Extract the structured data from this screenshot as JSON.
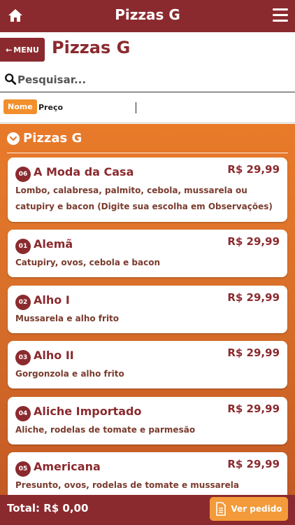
{
  "header": {
    "title": "Pizzas G",
    "home_icon": "home-icon",
    "menu_icon": "hamburger-menu-icon"
  },
  "subheader": {
    "back_label": "MENU",
    "page_title": "Pizzas G"
  },
  "search": {
    "placeholder": "Pesquisar...",
    "value": ""
  },
  "sort": {
    "nome_label": "Nome",
    "preco_label": "Preço",
    "active": "Nome"
  },
  "section": {
    "title": "Pizzas G"
  },
  "items": [
    {
      "num": "06",
      "name": "A Moda da Casa",
      "price": "R$ 29,99",
      "desc": "Lombo, calabresa, palmito, cebola, mussarela ou catupiry e bacon (Digite sua escolha em Observações)"
    },
    {
      "num": "01",
      "name": "Alemã",
      "price": "R$ 29,99",
      "desc": "Catupiry, ovos, cebola e bacon"
    },
    {
      "num": "02",
      "name": "Alho I",
      "price": "R$ 29,99",
      "desc": "Mussarela e alho frito"
    },
    {
      "num": "03",
      "name": "Alho II",
      "price": "R$ 29,99",
      "desc": "Gorgonzola e alho frito"
    },
    {
      "num": "04",
      "name": "Aliche Importado",
      "price": "R$ 29,99",
      "desc": "Aliche, rodelas de tomate e parmesão"
    },
    {
      "num": "05",
      "name": "Americana",
      "price": "R$ 29,99",
      "desc": "Presunto, ovos, rodelas de tomate e mussarela"
    }
  ],
  "footer": {
    "total": "Total: R$ 0,00",
    "ver_pedido": "Ver pedido"
  },
  "colors": {
    "primary": "#8b2a2e",
    "accent": "#f28f2c"
  }
}
